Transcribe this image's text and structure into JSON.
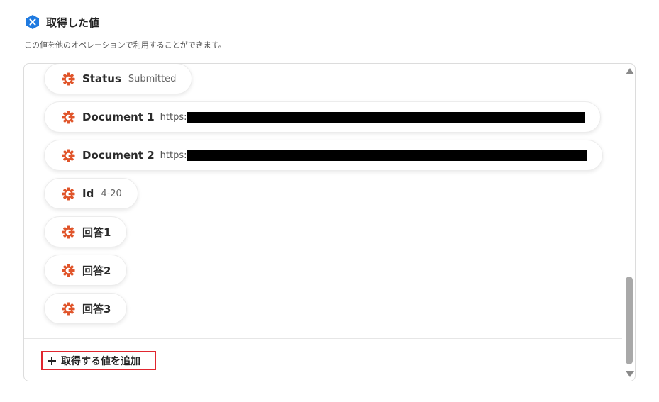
{
  "header": {
    "title": "取得した値",
    "description": "この値を他のオペレーションで利用することができます。"
  },
  "icons": {
    "logo": "hexagon-x-icon",
    "field": "gear-icon",
    "add": "plus-icon"
  },
  "colors": {
    "accent_blue": "#1f7ae0",
    "gear_orange": "#e0552b",
    "highlight_red": "#e0262f"
  },
  "fields": [
    {
      "label": "Status",
      "value": "Submitted"
    },
    {
      "label": "Document 1",
      "value": "https:"
    },
    {
      "label": "Document 2",
      "value": "https:"
    },
    {
      "label": "Id",
      "value": "4-20"
    },
    {
      "label": "回答1",
      "value": ""
    },
    {
      "label": "回答2",
      "value": ""
    },
    {
      "label": "回答3",
      "value": ""
    }
  ],
  "actions": {
    "add_label": "取得する値を追加"
  }
}
